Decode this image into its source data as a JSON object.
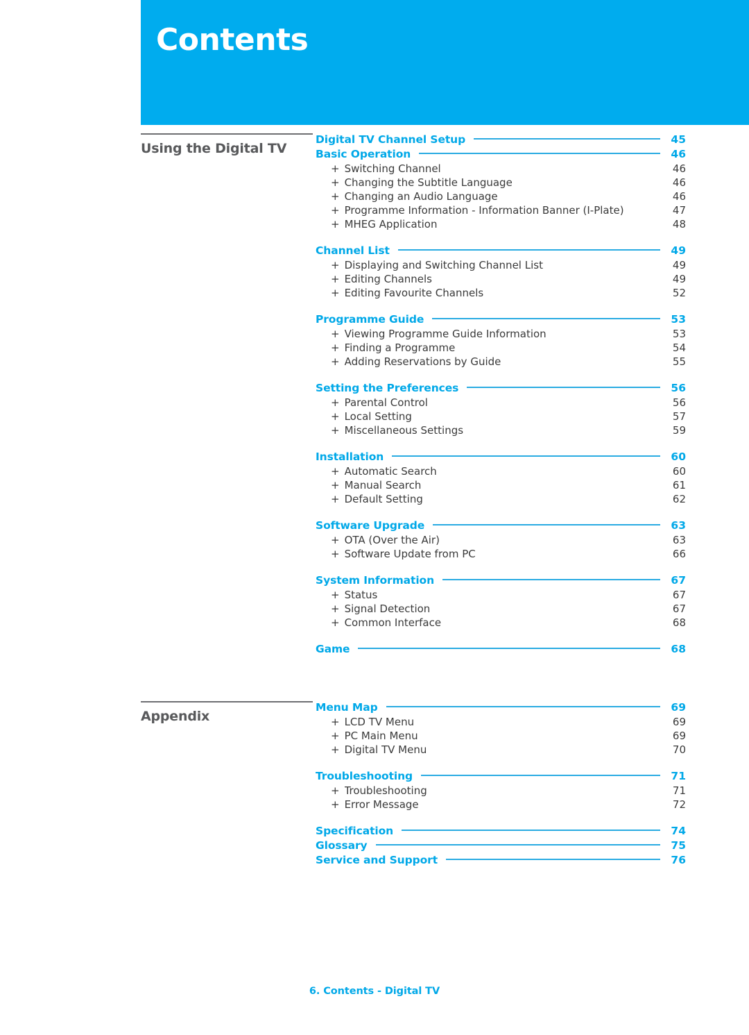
{
  "header": {
    "title": "Contents",
    "banner_color": "#00ACEE"
  },
  "colors": {
    "banner": "#00ACEE",
    "heading_blue": "#00A8E8",
    "leader_blue": "#29ABE2",
    "part_label_gray": "#58595b",
    "body_text": "#3a3a3a"
  },
  "parts": [
    {
      "label": "Using the Digital TV",
      "groups": [
        {
          "heading": "Digital TV Channel Setup",
          "page": "45",
          "items": []
        },
        {
          "heading": "Basic Operation",
          "page": "46",
          "items": [
            {
              "text": "Switching Channel",
              "page": "46"
            },
            {
              "text": "Changing the Subtitle Language",
              "page": "46"
            },
            {
              "text": "Changing an Audio Language",
              "page": "46"
            },
            {
              "text": "Programme Information - Information Banner (I-Plate)",
              "page": "47"
            },
            {
              "text": "MHEG Application",
              "page": "48"
            }
          ]
        },
        {
          "heading": "Channel List",
          "page": "49",
          "items": [
            {
              "text": "Displaying and Switching Channel List",
              "page": "49"
            },
            {
              "text": "Editing Channels",
              "page": "49"
            },
            {
              "text": "Editing Favourite Channels",
              "page": "52"
            }
          ]
        },
        {
          "heading": "Programme Guide",
          "page": "53",
          "items": [
            {
              "text": "Viewing Programme Guide Information",
              "page": "53"
            },
            {
              "text": "Finding a Programme",
              "page": "54"
            },
            {
              "text": "Adding Reservations by Guide",
              "page": "55"
            }
          ]
        },
        {
          "heading": "Setting the Preferences",
          "page": "56",
          "items": [
            {
              "text": "Parental Control",
              "page": "56"
            },
            {
              "text": "Local Setting",
              "page": "57"
            },
            {
              "text": "Miscellaneous Settings",
              "page": "59"
            }
          ]
        },
        {
          "heading": "Installation",
          "page": "60",
          "items": [
            {
              "text": "Automatic Search",
              "page": "60"
            },
            {
              "text": "Manual Search",
              "page": "61"
            },
            {
              "text": "Default Setting",
              "page": "62"
            }
          ]
        },
        {
          "heading": "Software Upgrade",
          "page": "63",
          "items": [
            {
              "text": "OTA (Over the Air)",
              "page": "63"
            },
            {
              "text": "Software Update from PC",
              "page": "66"
            }
          ]
        },
        {
          "heading": "System Information",
          "page": "67",
          "items": [
            {
              "text": "Status",
              "page": "67"
            },
            {
              "text": "Signal Detection",
              "page": "67"
            },
            {
              "text": "Common Interface",
              "page": "68"
            }
          ]
        },
        {
          "heading": "Game",
          "page": "68",
          "items": []
        }
      ]
    },
    {
      "label": "Appendix",
      "groups": [
        {
          "heading": "Menu Map",
          "page": "69",
          "items": [
            {
              "text": "LCD TV Menu",
              "page": "69"
            },
            {
              "text": "PC Main Menu",
              "page": "69"
            },
            {
              "text": "Digital TV Menu",
              "page": "70"
            }
          ]
        },
        {
          "heading": "Troubleshooting",
          "page": "71",
          "items": [
            {
              "text": "Troubleshooting",
              "page": "71"
            },
            {
              "text": "Error Message",
              "page": "72"
            }
          ]
        },
        {
          "heading": "Specification",
          "page": "74",
          "items": []
        },
        {
          "heading": "Glossary",
          "page": "75",
          "items": []
        },
        {
          "heading": "Service and Support",
          "page": "76",
          "items": []
        }
      ]
    }
  ],
  "footer": {
    "text": "6. Contents - Digital TV"
  },
  "item_marker": "+"
}
